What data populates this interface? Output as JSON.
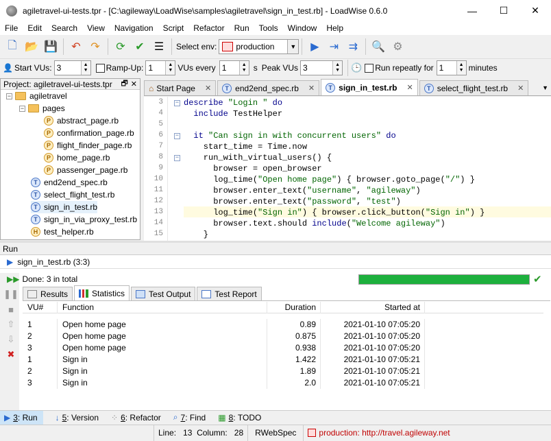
{
  "window": {
    "title": "agiletravel-ui-tests.tpr - [C:\\agileway\\LoadWise\\samples\\agiletravel\\sign_in_test.rb] - LoadWise 0.6.0",
    "minimize": "—",
    "maximize": "☐",
    "close": "✕"
  },
  "menu": [
    "File",
    "Edit",
    "Search",
    "View",
    "Navigation",
    "Script",
    "Refactor",
    "Run",
    "Tools",
    "Window",
    "Help"
  ],
  "toolbar": {
    "select_env_label": "Select env:",
    "env_value": "production"
  },
  "loadbar": {
    "start_vus_label": "Start VUs:",
    "start_vus": "3",
    "rampup_label": "Ramp-Up:",
    "rampup": "1",
    "vus_every_label": "VUs every",
    "vus_every": "1",
    "s_label": "s",
    "peak_vus_label": "Peak VUs",
    "peak_vus": "3",
    "repeat_label": "Run repeatly for",
    "repeat": "1",
    "minutes_label": "minutes"
  },
  "project": {
    "header": "Project: agiletravel-ui-tests.tpr",
    "root": "agiletravel",
    "folder": "pages",
    "pages": [
      "abstract_page.rb",
      "confirmation_page.rb",
      "flight_finder_page.rb",
      "home_page.rb",
      "passenger_page.rb"
    ],
    "tests": [
      "end2end_spec.rb",
      "select_flight_test.rb",
      "sign_in_test.rb",
      "sign_in_via_proxy_test.rb"
    ],
    "helper": "test_helper.rb",
    "page_icon_letter": "P",
    "test_icon_letter": "T",
    "helper_icon_letter": "H"
  },
  "tabs": [
    "Start Page",
    "end2end_spec.rb",
    "sign_in_test.rb",
    "select_flight_test.rb"
  ],
  "editor": {
    "line_numbers": [
      "3",
      "4",
      "5",
      "6",
      "7",
      "8",
      "9",
      "10",
      "11",
      "12",
      "13",
      "14",
      "15"
    ],
    "lines": [
      [
        [
          "kw",
          "describe "
        ],
        [
          "str",
          "\"Login \""
        ],
        [
          "kw",
          " do"
        ]
      ],
      [
        [
          "kw",
          "  include "
        ],
        [
          "",
          "TestHelper"
        ]
      ],
      [
        [
          "",
          ""
        ]
      ],
      [
        [
          "kw",
          "  it "
        ],
        [
          "str",
          "\"Can sign in with concurrent users\""
        ],
        [
          "kw",
          " do"
        ]
      ],
      [
        [
          "",
          "    start_time = Time.now"
        ]
      ],
      [
        [
          "",
          "    run_with_virtual_users() {"
        ]
      ],
      [
        [
          "",
          "      browser = open_browser"
        ]
      ],
      [
        [
          "",
          "      log_time("
        ],
        [
          "str",
          "\"Open home page\""
        ],
        [
          "",
          ") { browser.goto_page("
        ],
        [
          "str",
          "\"/\""
        ],
        [
          "",
          ") }"
        ]
      ],
      [
        [
          "",
          "      browser.enter_text("
        ],
        [
          "str",
          "\"username\""
        ],
        [
          "",
          ", "
        ],
        [
          "str",
          "\"agileway\""
        ],
        [
          "",
          ")"
        ]
      ],
      [
        [
          "",
          "      browser.enter_text("
        ],
        [
          "str",
          "\"password\""
        ],
        [
          "",
          ", "
        ],
        [
          "str",
          "\"test\""
        ],
        [
          "",
          ")"
        ]
      ],
      [
        [
          "",
          "      log_time("
        ],
        [
          "str",
          "\"Sign in\""
        ],
        [
          "",
          ") { browser.click_button("
        ],
        [
          "str",
          "\"Sign in\""
        ],
        [
          "",
          ") }"
        ]
      ],
      [
        [
          "",
          "      browser.text.should "
        ],
        [
          "kw",
          "include"
        ],
        [
          "",
          "("
        ],
        [
          "str",
          "\"Welcome agileway\""
        ],
        [
          "",
          ")"
        ]
      ],
      [
        [
          "",
          "    }"
        ]
      ]
    ]
  },
  "run": {
    "panel_title": "Run",
    "test_name": "sign_in_test.rb (3:3)",
    "status": "Done: 3 in total",
    "progress": 1.0,
    "subtabs": [
      "Results",
      "Statistics",
      "Test Output",
      "Test Report"
    ],
    "columns": [
      "VU#",
      "Function",
      "Duration",
      "Started at"
    ],
    "rows": [
      [
        "1",
        "Open home page",
        "0.89",
        "2021-01-10 07:05:20"
      ],
      [
        "2",
        "Open home page",
        "0.875",
        "2021-01-10 07:05:20"
      ],
      [
        "3",
        "Open home page",
        "0.938",
        "2021-01-10 07:05:20"
      ],
      [
        "1",
        "Sign in",
        "1.422",
        "2021-01-10 07:05:21"
      ],
      [
        "2",
        "Sign in",
        "1.89",
        "2021-01-10 07:05:21"
      ],
      [
        "3",
        "Sign in",
        "2.0",
        "2021-01-10 07:05:21"
      ]
    ]
  },
  "bottom_tabs": [
    {
      "num": "3",
      "label": "Run"
    },
    {
      "num": "5",
      "label": "Version"
    },
    {
      "num": "6",
      "label": "Refactor"
    },
    {
      "num": "7",
      "label": "Find"
    },
    {
      "num": "8",
      "label": "TODO"
    }
  ],
  "status": {
    "line_label": "Line:",
    "line": "13",
    "column_label": "Column:",
    "column": "28",
    "mode": "RWebSpec",
    "env": "production: http://travel.agileway.net"
  },
  "colors": {
    "accent": "#1db03d",
    "keyword": "#00008b",
    "string": "#006400"
  }
}
